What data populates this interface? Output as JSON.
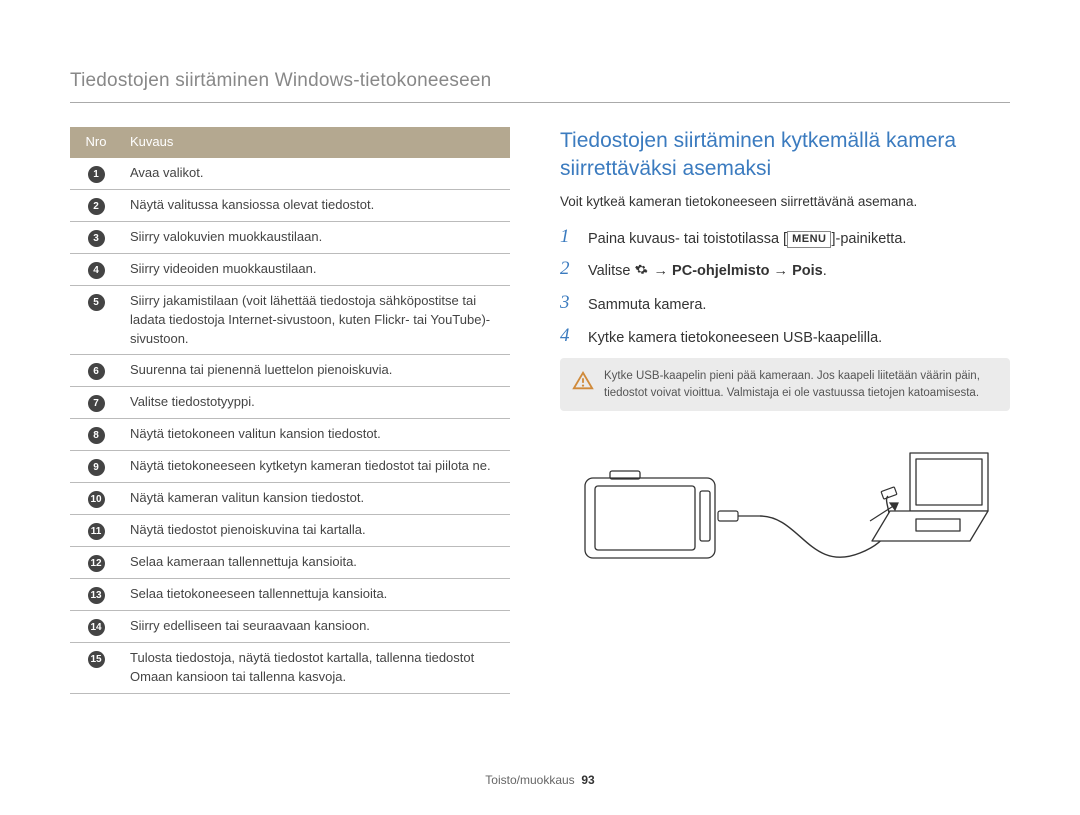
{
  "header": {
    "title": "Tiedostojen siirtäminen Windows-tietokoneeseen"
  },
  "table": {
    "head": {
      "nro": "Nro",
      "kuvaus": "Kuvaus"
    },
    "rows": [
      {
        "n": "1",
        "desc": "Avaa valikot."
      },
      {
        "n": "2",
        "desc": "Näytä valitussa kansiossa olevat tiedostot."
      },
      {
        "n": "3",
        "desc": "Siirry valokuvien muokkaustilaan."
      },
      {
        "n": "4",
        "desc": "Siirry videoiden muokkaustilaan."
      },
      {
        "n": "5",
        "desc": "Siirry jakamistilaan (voit lähettää tiedostoja sähköpostitse tai ladata tiedostoja Internet-sivustoon, kuten Flickr- tai YouTube)-sivustoon."
      },
      {
        "n": "6",
        "desc": "Suurenna tai pienennä luettelon pienoiskuvia."
      },
      {
        "n": "7",
        "desc": "Valitse tiedostotyyppi."
      },
      {
        "n": "8",
        "desc": "Näytä tietokoneen valitun kansion tiedostot."
      },
      {
        "n": "9",
        "desc": "Näytä tietokoneeseen kytketyn kameran tiedostot tai piilota ne."
      },
      {
        "n": "10",
        "desc": "Näytä kameran valitun kansion tiedostot."
      },
      {
        "n": "11",
        "desc": "Näytä tiedostot pienoiskuvina tai kartalla."
      },
      {
        "n": "12",
        "desc": "Selaa kameraan tallennettuja kansioita."
      },
      {
        "n": "13",
        "desc": "Selaa tietokoneeseen tallennettuja kansioita."
      },
      {
        "n": "14",
        "desc": "Siirry edelliseen tai seuraavaan kansioon."
      },
      {
        "n": "15",
        "desc": "Tulosta tiedostoja, näytä tiedostot kartalla, tallenna tiedostot Omaan kansioon tai tallenna kasvoja."
      }
    ]
  },
  "right": {
    "title": "Tiedostojen siirtäminen kytkemällä kamera siirrettäväksi asemaksi",
    "sub": "Voit kytkeä kameran tietokoneeseen siirrettävänä asemana.",
    "steps": {
      "s1_a": "Paina kuvaus- tai toistotilassa [",
      "s1_menu": "MENU",
      "s1_b": "]-painiketta.",
      "s2_a": "Valitse ",
      "s2_arrow1": " → ",
      "s2_b": "PC-ohjelmisto",
      "s2_arrow2": " → ",
      "s2_c": "Pois",
      "s2_d": ".",
      "s3": "Sammuta kamera.",
      "s4": "Kytke kamera tietokoneeseen USB-kaapelilla."
    },
    "callout": "Kytke USB-kaapelin pieni pää kameraan. Jos kaapeli liitetään väärin päin, tiedostot voivat vioittua. Valmistaja ei ole vastuussa tietojen katoamisesta."
  },
  "footer": {
    "section": "Toisto/muokkaus",
    "page": "93"
  }
}
